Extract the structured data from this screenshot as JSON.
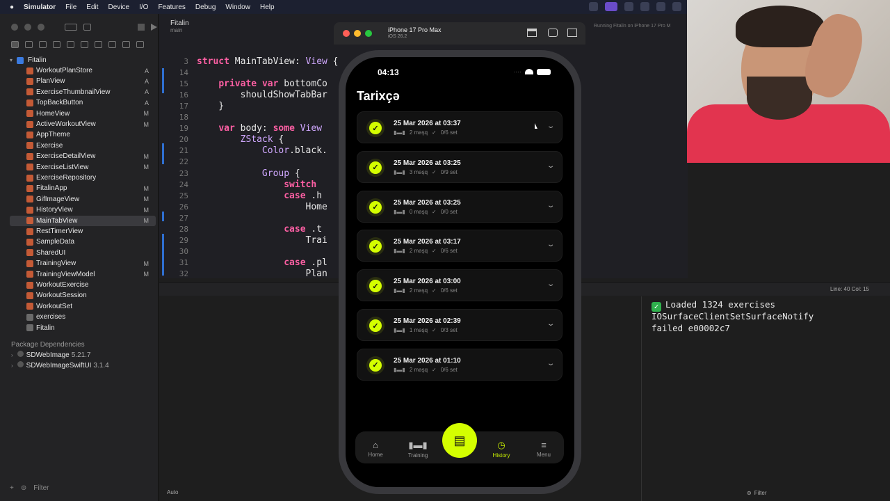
{
  "menubar": {
    "app": "Simulator",
    "items": [
      "File",
      "Edit",
      "Device",
      "I/O",
      "Features",
      "Debug",
      "Window",
      "Help"
    ]
  },
  "xcode": {
    "scheme": "Fitalin",
    "branch": "main",
    "running": "Running Fitalin on iPhone 17 Pro M",
    "project_root": "Fitalin",
    "files": [
      {
        "name": "WorkoutPlanStore",
        "status": "A"
      },
      {
        "name": "PlanView",
        "status": "A"
      },
      {
        "name": "ExerciseThumbnailView",
        "status": "A"
      },
      {
        "name": "TopBackButton",
        "status": "A"
      },
      {
        "name": "HomeView",
        "status": "M"
      },
      {
        "name": "ActiveWorkoutView",
        "status": "M"
      },
      {
        "name": "AppTheme",
        "status": ""
      },
      {
        "name": "Exercise",
        "status": ""
      },
      {
        "name": "ExerciseDetailView",
        "status": "M"
      },
      {
        "name": "ExerciseListView",
        "status": "M"
      },
      {
        "name": "ExerciseRepository",
        "status": ""
      },
      {
        "name": "FitalinApp",
        "status": "M"
      },
      {
        "name": "GifImageView",
        "status": "M"
      },
      {
        "name": "HistoryView",
        "status": "M"
      },
      {
        "name": "MainTabView",
        "status": "M"
      },
      {
        "name": "RestTimerView",
        "status": ""
      },
      {
        "name": "SampleData",
        "status": ""
      },
      {
        "name": "SharedUI",
        "status": ""
      },
      {
        "name": "TrainingView",
        "status": "M"
      },
      {
        "name": "TrainingViewModel",
        "status": "M"
      },
      {
        "name": "WorkoutExercise",
        "status": ""
      },
      {
        "name": "WorkoutSession",
        "status": ""
      },
      {
        "name": "WorkoutSet",
        "status": ""
      },
      {
        "name": "exercises",
        "status": ""
      },
      {
        "name": "Fitalin",
        "status": ""
      }
    ],
    "packages_header": "Package Dependencies",
    "packages": [
      {
        "name": "SDWebImage",
        "version": "5.21.7"
      },
      {
        "name": "SDWebImageSwiftUI",
        "version": "3.1.4"
      }
    ],
    "filter_placeholder": "Filter",
    "code_lines": [
      {
        "n": "3",
        "text": "struct MainTabView: View {"
      },
      {
        "n": "14",
        "text": ""
      },
      {
        "n": "15",
        "text": "    private var bottomCo"
      },
      {
        "n": "16",
        "text": "        shouldShowTabBar"
      },
      {
        "n": "17",
        "text": "    }"
      },
      {
        "n": "18",
        "text": ""
      },
      {
        "n": "19",
        "text": "    var body: some View"
      },
      {
        "n": "20",
        "text": "        ZStack {"
      },
      {
        "n": "21",
        "text": "            Color.black."
      },
      {
        "n": "22",
        "text": ""
      },
      {
        "n": "23",
        "text": "            Group {"
      },
      {
        "n": "24",
        "text": "                switch"
      },
      {
        "n": "25",
        "text": "                case .h"
      },
      {
        "n": "26",
        "text": "                    Home"
      },
      {
        "n": "27",
        "text": ""
      },
      {
        "n": "28",
        "text": "                case .t"
      },
      {
        "n": "29",
        "text": "                    Trai"
      },
      {
        "n": "30",
        "text": ""
      },
      {
        "n": "31",
        "text": "                case .pl"
      },
      {
        "n": "32",
        "text": "                    Plan"
      }
    ],
    "line_col": "Line: 40  Col: 15",
    "auto_label": "Auto",
    "console": [
      "Loaded 1324 exercises",
      "IOSurfaceClientSetSurfaceNotify",
      "failed e00002c7"
    ]
  },
  "simulator": {
    "device": "iPhone 17 Pro Max",
    "os": "iOS 26.2",
    "time": "04:13",
    "screen_title": "Tarixçə",
    "accent": "#d4ff00",
    "sessions": [
      {
        "date": "25 Mar 2026 at 03:37",
        "exercises": "2 məşq",
        "sets": "0/6 set"
      },
      {
        "date": "25 Mar 2026 at 03:25",
        "exercises": "3 məşq",
        "sets": "0/9 set"
      },
      {
        "date": "25 Mar 2026 at 03:25",
        "exercises": "0 məşq",
        "sets": "0/0 set"
      },
      {
        "date": "25 Mar 2026 at 03:17",
        "exercises": "2 məşq",
        "sets": "0/6 set"
      },
      {
        "date": "25 Mar 2026 at 03:00",
        "exercises": "2 məşq",
        "sets": "0/6 set"
      },
      {
        "date": "25 Mar 2026 at 02:39",
        "exercises": "1 məşq",
        "sets": "0/3 set"
      },
      {
        "date": "25 Mar 2026 at 01:10",
        "exercises": "2 məşq",
        "sets": "0/6 set"
      }
    ],
    "tabs": [
      {
        "label": "Home",
        "icon": "house-icon"
      },
      {
        "label": "Training",
        "icon": "dumbbell-icon"
      },
      {
        "label": "History",
        "icon": "clock-icon",
        "active": true
      },
      {
        "label": "Menu",
        "icon": "menu-icon"
      }
    ],
    "fab_icon": "clipboard-icon"
  }
}
